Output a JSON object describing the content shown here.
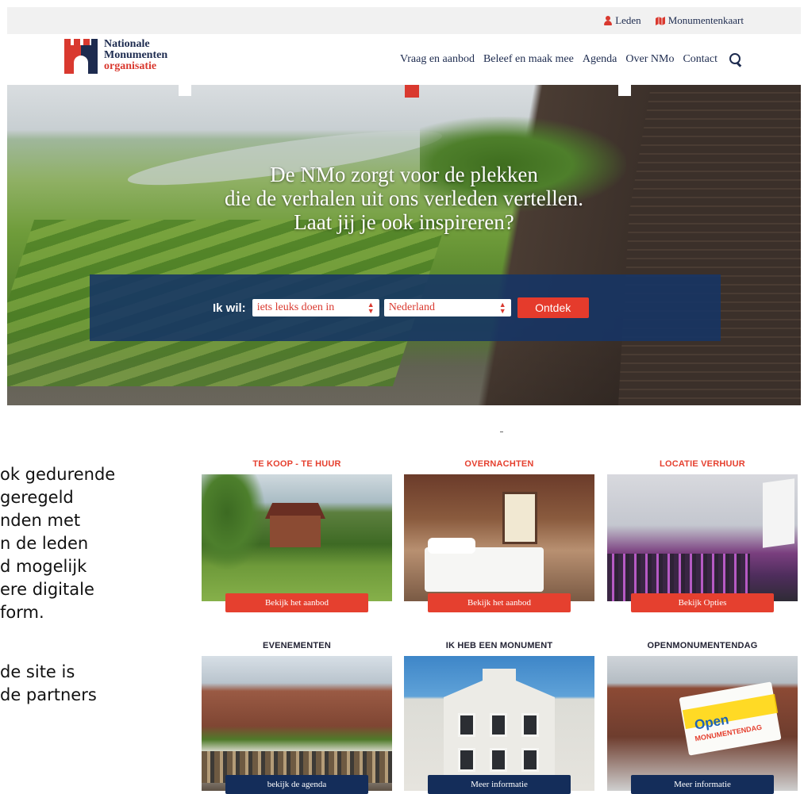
{
  "topbar": {
    "leden": "Leden",
    "monumentenkaart": "Monumentenkaart"
  },
  "logo": {
    "line1": "Nationale",
    "line2": "Monumenten",
    "line3": "organisatie"
  },
  "nav": {
    "items": [
      "Vraag en aanbod",
      "Beleef en maak mee",
      "Agenda",
      "Over NMo",
      "Contact"
    ]
  },
  "hero": {
    "line1": "De NMo zorgt voor de plekken",
    "line2": "die de verhalen uit ons verleden vertellen.",
    "line3": "Laat jij je ook inspireren?"
  },
  "search": {
    "label": "Ik wil:",
    "select1": "iets leuks doen in",
    "select2": "Nederland",
    "button": "Ontdek"
  },
  "side_text": {
    "p1": [
      "ok gedurende",
      "geregeld",
      "nden met",
      "n de leden",
      "d mogelijk",
      "ere digitale",
      "form."
    ],
    "p2": [
      "de site is",
      "de partners"
    ]
  },
  "cards": [
    {
      "title": "TE KOOP - TE HUUR",
      "button": "Bekijk het aanbod"
    },
    {
      "title": "OVERNACHTEN",
      "button": "Bekijk het aanbod"
    },
    {
      "title": "LOCATIE VERHUUR",
      "button": "Bekijk Opties"
    },
    {
      "title": "EVENEMENTEN",
      "button": "bekijk de agenda"
    },
    {
      "title": "IK HEB EEN MONUMENT",
      "button": "Meer informatie"
    },
    {
      "title": "OPENMONUMENTENDAG",
      "button": "Meer informatie"
    }
  ],
  "omd_banner": {
    "text": "Open",
    "sub": "MONUMENTENDAG"
  },
  "colors": {
    "navy": "#1d2b4f",
    "red": "#e5402f",
    "panel": "#163465"
  },
  "icons": {
    "leden": "user-icon",
    "kaart": "map-icon",
    "search": "search-icon"
  }
}
